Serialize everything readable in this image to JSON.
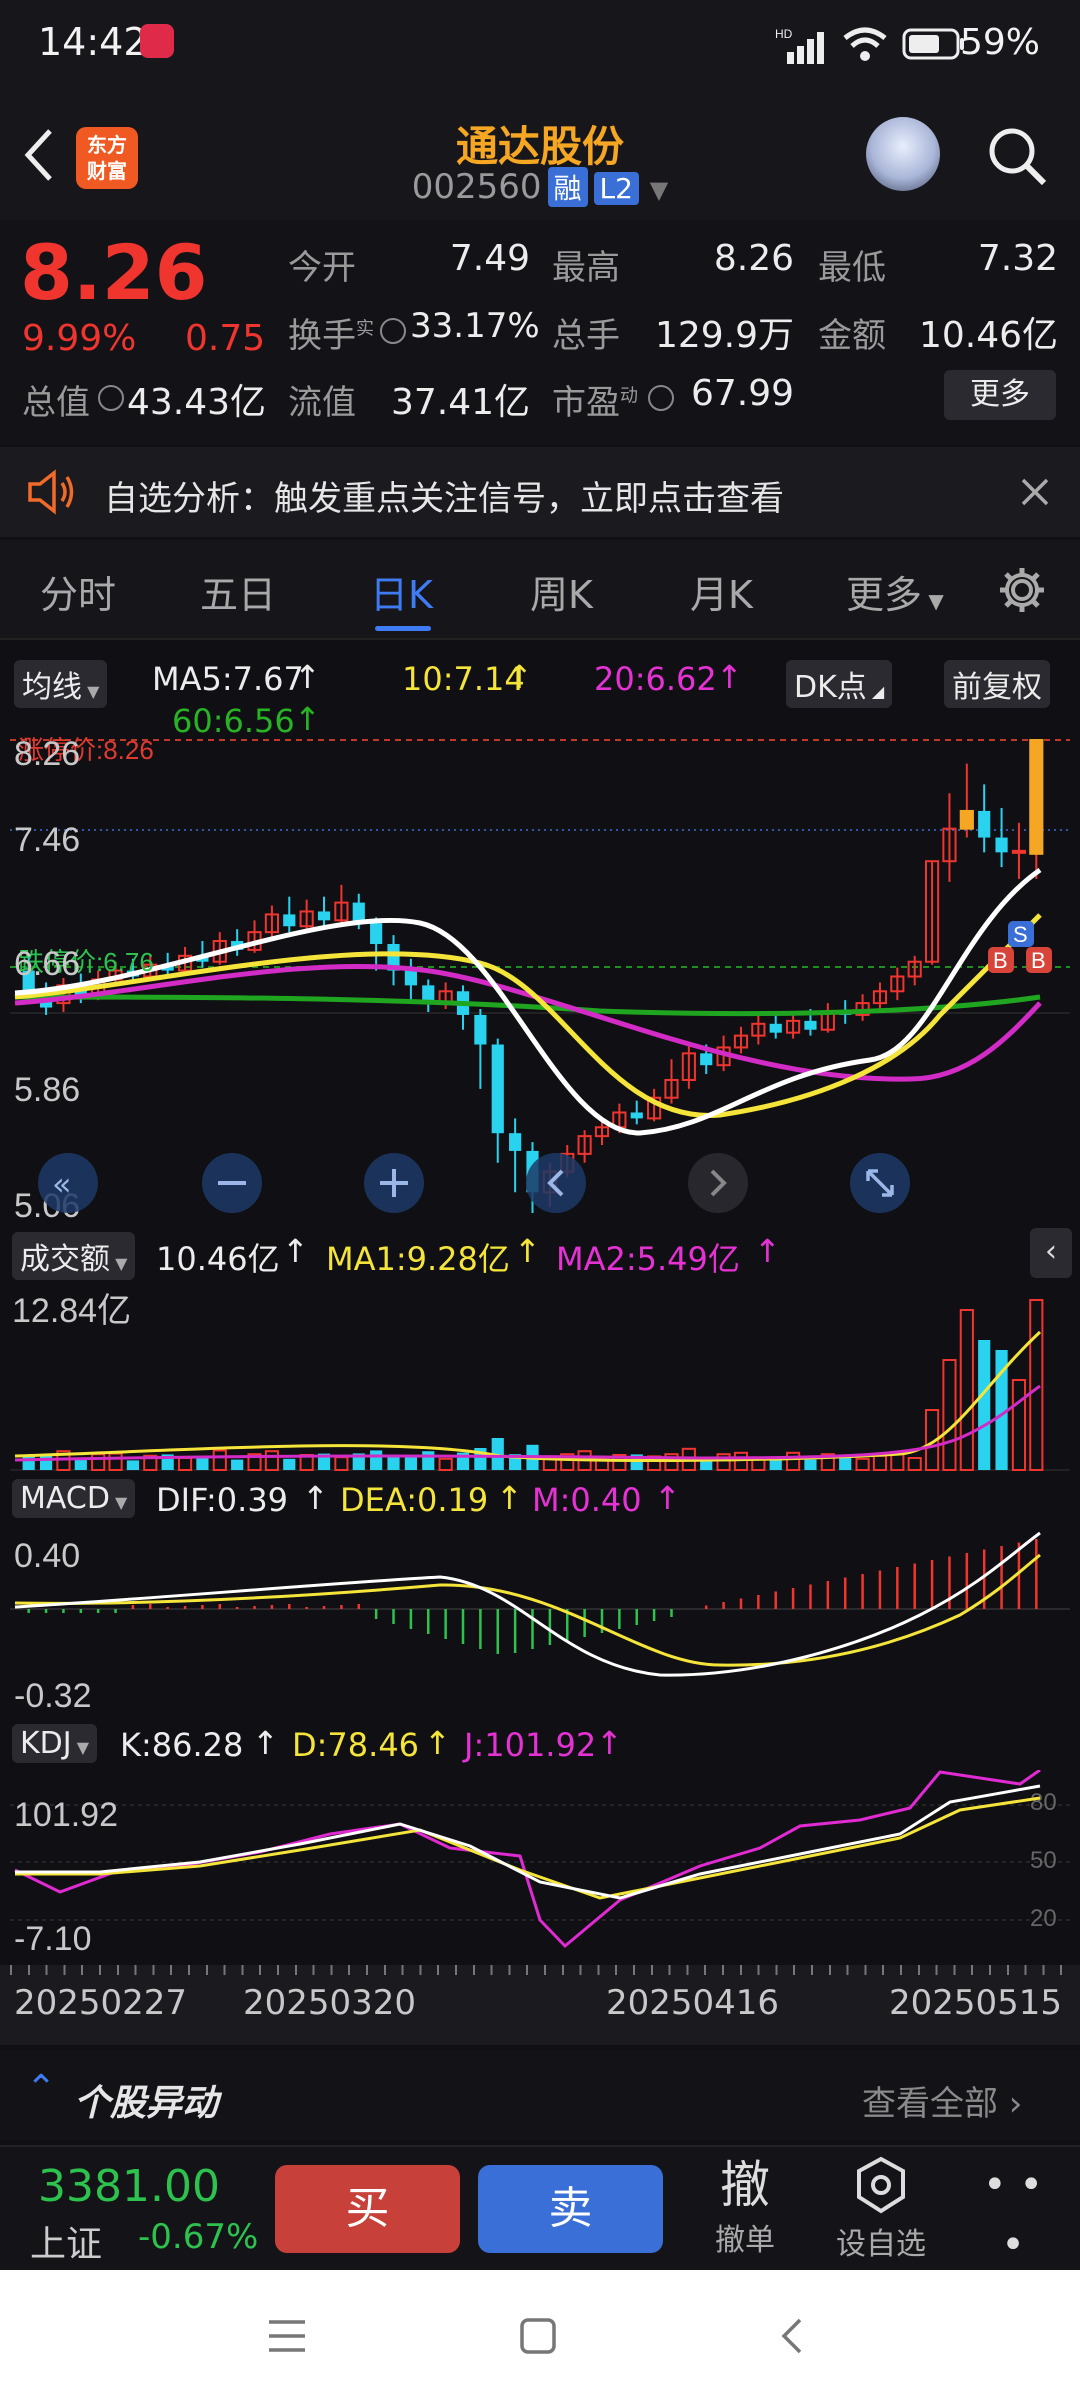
{
  "status_bar": {
    "time": "14:42",
    "battery": "59%"
  },
  "header": {
    "stock_name": "通达股份",
    "stock_code": "002560",
    "tag_margin": "融",
    "tag_level": "L2",
    "logo_line1": "东方",
    "logo_line2": "财富"
  },
  "quote": {
    "price": "8.26",
    "change_pct": "9.99%",
    "change": "0.75",
    "open_label": "今开",
    "open": "7.49",
    "high_label": "最高",
    "high": "8.26",
    "low_label": "最低",
    "low": "7.32",
    "turnover_label": "换手",
    "turnover_sup": "实",
    "turnover": "33.17%",
    "volume_label": "总手",
    "volume": "129.9万",
    "amount_label": "金额",
    "amount": "10.46亿",
    "mcap_label": "总值",
    "mcap": "43.43亿",
    "float_label": "流值",
    "float": "37.41亿",
    "pe_label": "市盈",
    "pe_sup": "动",
    "pe": "67.99",
    "more_label": "更多"
  },
  "banner": {
    "text": "自选分析：触发重点关注信号，立即点击查看"
  },
  "tabs": [
    {
      "label": "分时"
    },
    {
      "label": "五日"
    },
    {
      "label": "日K"
    },
    {
      "label": "周K"
    },
    {
      "label": "月K"
    },
    {
      "label": "更多"
    }
  ],
  "kline": {
    "indicator": "均线",
    "ma5": "MA5:7.67",
    "ma10": "10:7.14",
    "ma20": "20:6.62",
    "ma60": "60:6.56",
    "dk_label": "DK点",
    "adjust_label": "前复权",
    "limit_up": "涨停价:8.26",
    "limit_down": "跌停价:6.76",
    "y_labels": [
      "8.26",
      "7.46",
      "6.66",
      "5.86",
      "5.06"
    ],
    "marker_s": "S",
    "marker_b": "B"
  },
  "volume": {
    "label": "成交额",
    "value": "10.46亿",
    "ma1": "MA1:9.28亿",
    "ma2": "MA2:5.49亿",
    "y_label": "12.84亿"
  },
  "macd": {
    "label": "MACD",
    "dif": "DIF:0.39",
    "dea": "DEA:0.19",
    "m": "M:0.40",
    "y_top": "0.40",
    "y_bottom": "-0.32"
  },
  "kdj": {
    "label": "KDJ",
    "k": "K:86.28",
    "d": "D:78.46",
    "j": "J:101.92",
    "y_top": "101.92",
    "y_bottom": "-7.10",
    "levels": [
      "80",
      "50",
      "20"
    ]
  },
  "dates": [
    "20250227",
    "20250320",
    "20250416",
    "20250515"
  ],
  "news": {
    "title": "个股异动",
    "more": "查看全部"
  },
  "bottom": {
    "index_value": "3381.00",
    "index_name": "上证",
    "index_change": "-0.67%",
    "buy": "买",
    "sell": "卖",
    "cancel_icon_char": "撤",
    "cancel": "撤单",
    "watch": "设自选",
    "more": "更多"
  },
  "colors": {
    "up": "#f0352f",
    "down": "#2dc24e",
    "cyan": "#29d3f0",
    "ma5": "#ffffff",
    "ma10": "#f5e43a",
    "ma20": "#d22bc6",
    "ma60": "#1fa51f",
    "accent": "#3f7cf4",
    "brand": "#f5a623"
  },
  "chart_data": {
    "type": "candlestick",
    "x_labels": [
      "20250227",
      "20250320",
      "20250416",
      "20250515"
    ],
    "y_ticks": [
      8.26,
      7.46,
      6.66,
      5.86,
      5.06
    ],
    "ylim": [
      5.06,
      8.26
    ],
    "candles": [
      [
        6.7,
        6.55,
        6.8,
        6.5
      ],
      [
        6.55,
        6.45,
        6.62,
        6.4
      ],
      [
        6.48,
        6.6,
        6.65,
        6.42
      ],
      [
        6.6,
        6.52,
        6.68,
        6.48
      ],
      [
        6.52,
        6.64,
        6.7,
        6.5
      ],
      [
        6.64,
        6.7,
        6.76,
        6.6
      ],
      [
        6.7,
        6.66,
        6.78,
        6.62
      ],
      [
        6.66,
        6.74,
        6.8,
        6.64
      ],
      [
        6.74,
        6.7,
        6.82,
        6.66
      ],
      [
        6.7,
        6.8,
        6.86,
        6.68
      ],
      [
        6.8,
        6.76,
        6.9,
        6.72
      ],
      [
        6.76,
        6.9,
        6.96,
        6.74
      ],
      [
        6.9,
        6.84,
        6.98,
        6.8
      ],
      [
        6.84,
        6.96,
        7.04,
        6.82
      ],
      [
        6.96,
        7.08,
        7.14,
        6.92
      ],
      [
        7.08,
        7.0,
        7.2,
        6.96
      ],
      [
        7.0,
        7.1,
        7.18,
        6.98
      ],
      [
        7.1,
        7.04,
        7.2,
        7.0
      ],
      [
        7.04,
        7.16,
        7.28,
        7.02
      ],
      [
        7.16,
        7.02,
        7.22,
        6.98
      ],
      [
        7.02,
        6.88,
        7.06,
        6.7
      ],
      [
        6.88,
        6.7,
        6.94,
        6.6
      ],
      [
        6.7,
        6.6,
        6.78,
        6.5
      ],
      [
        6.6,
        6.48,
        6.64,
        6.42
      ],
      [
        6.48,
        6.56,
        6.62,
        6.44
      ],
      [
        6.56,
        6.4,
        6.6,
        6.3
      ],
      [
        6.4,
        6.2,
        6.44,
        5.9
      ],
      [
        6.2,
        5.6,
        6.24,
        5.4
      ],
      [
        5.6,
        5.48,
        5.7,
        5.2
      ],
      [
        5.48,
        5.2,
        5.54,
        5.06
      ],
      [
        5.2,
        5.34,
        5.4,
        5.1
      ],
      [
        5.34,
        5.46,
        5.52,
        5.3
      ],
      [
        5.46,
        5.58,
        5.62,
        5.4
      ],
      [
        5.58,
        5.64,
        5.7,
        5.52
      ],
      [
        5.64,
        5.74,
        5.8,
        5.6
      ],
      [
        5.74,
        5.7,
        5.82,
        5.66
      ],
      [
        5.7,
        5.84,
        5.9,
        5.68
      ],
      [
        5.84,
        5.96,
        6.1,
        5.8
      ],
      [
        5.96,
        6.14,
        6.22,
        5.9
      ],
      [
        6.14,
        6.06,
        6.2,
        6.0
      ],
      [
        6.06,
        6.18,
        6.26,
        6.02
      ],
      [
        6.18,
        6.26,
        6.32,
        6.14
      ],
      [
        6.26,
        6.34,
        6.4,
        6.2
      ],
      [
        6.34,
        6.28,
        6.4,
        6.24
      ],
      [
        6.28,
        6.36,
        6.42,
        6.24
      ],
      [
        6.36,
        6.3,
        6.44,
        6.26
      ],
      [
        6.3,
        6.42,
        6.48,
        6.28
      ],
      [
        6.42,
        6.4,
        6.5,
        6.34
      ],
      [
        6.4,
        6.48,
        6.54,
        6.36
      ],
      [
        6.48,
        6.56,
        6.62,
        6.44
      ],
      [
        6.56,
        6.66,
        6.72,
        6.5
      ],
      [
        6.66,
        6.76,
        6.8,
        6.6
      ],
      [
        6.76,
        7.44,
        7.44,
        6.74
      ],
      [
        7.44,
        7.66,
        7.9,
        7.3
      ],
      [
        7.66,
        7.78,
        8.1,
        7.6
      ],
      [
        7.78,
        7.6,
        7.96,
        7.5
      ],
      [
        7.6,
        7.5,
        7.8,
        7.4
      ],
      [
        7.5,
        7.51,
        7.7,
        7.32
      ],
      [
        7.49,
        8.26,
        8.26,
        7.32
      ]
    ]
  }
}
